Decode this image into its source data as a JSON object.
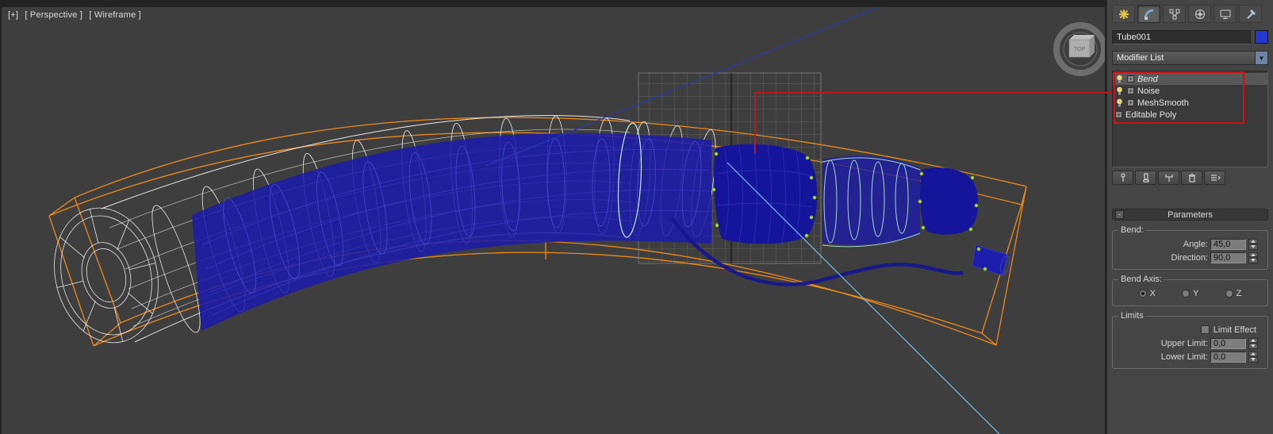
{
  "viewport": {
    "menus": {
      "general": "[+]",
      "pov": "[ Perspective ]",
      "shading": "[ Wireframe ]"
    },
    "viewcube_label": "TOP"
  },
  "panel": {
    "tabs": [
      "create-icon",
      "modify-icon",
      "hierarchy-icon",
      "motion-icon",
      "display-icon",
      "utilities-icon"
    ],
    "object_name": "Tube001",
    "modifier_list": "Modifier List",
    "dropdown_arrow": "▼",
    "stack": [
      {
        "label": "Bend"
      },
      {
        "label": "Noise"
      },
      {
        "label": "MeshSmooth"
      },
      {
        "label": "Editable Poly"
      }
    ],
    "stack_tools": [
      "pin-stack-icon",
      "show-end-result-icon",
      "make-unique-icon",
      "remove-modifier-icon",
      "configure-modifier-sets-icon"
    ],
    "rollout": {
      "collapse_glyph": "-",
      "title": "Parameters",
      "bend": {
        "group": "Bend:",
        "angle_label": "Angle:",
        "angle_value": "45,0",
        "direction_label": "Direction:",
        "direction_value": "90,0"
      },
      "axis": {
        "group": "Bend Axis:",
        "options": [
          "X",
          "Y",
          "Z"
        ],
        "selected": "X"
      },
      "limits": {
        "group": "Limits",
        "limit_effect": "Limit Effect",
        "upper_label": "Upper Limit:",
        "upper_value": "0,0",
        "lower_label": "Lower Limit:",
        "lower_value": "0,0"
      }
    }
  },
  "colors": {
    "annotation_red": "#c81414",
    "gizmo_orange": "#ef8a1a",
    "mesh_blue": "#1c1caa",
    "mesh_mint": "#b9eed6",
    "object_color": "#2438d8"
  }
}
